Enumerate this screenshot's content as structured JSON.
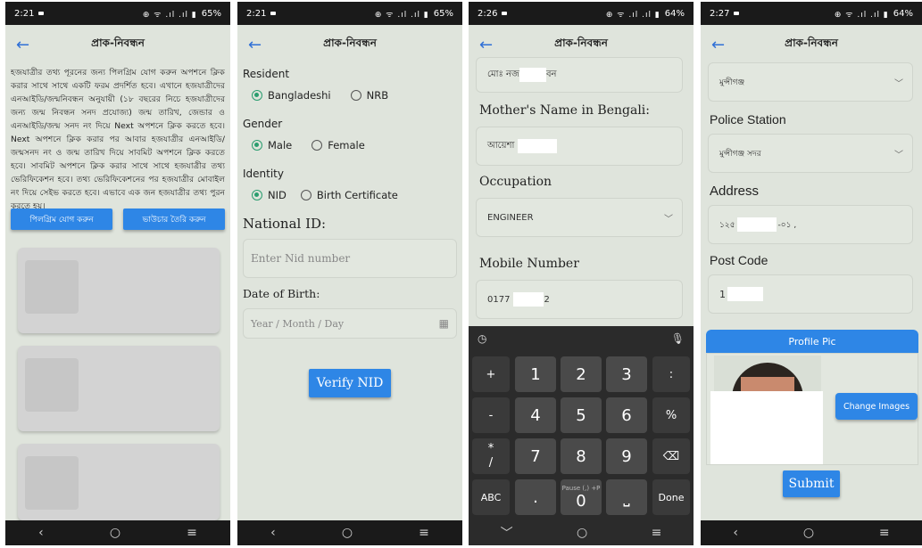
{
  "common": {
    "app_title": "প্রাক-নিবন্ধন",
    "nav": [
      "‹",
      "○",
      "≡"
    ]
  },
  "phone1": {
    "time": "2:21",
    "battery": "65%",
    "paragraph": "হজযাত্রীর তথ্য পূরনের জন্য পিলগ্রিম যোগ করুন অপশনে ক্লিক করার সাথে সাথে একটি ফরম প্রদর্শিত হবে। এখানে হজযাত্রীদের এনআইডি/জন্মনিবন্ধন অনুযায়ী (১৮ বছরের নিচে হজযাত্রীদের জন্য জন্ম নিবন্ধন সনদ প্রযোজ্য) জন্ম তারিখ, জেন্ডার ও এনআইডি/জন্ম সনদ নং দিয়ে Next অপশনে ক্লিক করতে হবে। Next অপশনে ক্লিক করার পর আবার হজযাত্রীর এনআইডি/জন্মসনদ নং ও জন্ম তারিখ দিয়ে সাবমিট অপশনে ক্লিক করতে হবে। সাবমিট অপশনে ক্লিক করার সাথে সাথে হজযাত্রীর তথ্য ভেরিফিকেশন হবে। তথ্য ভেরিফিকেশনের পর হজযাত্রীর মোবাইল নং দিয়ে সেইভ করতে হবে। এভাবে এক জন হজযাত্রীর তথ্য পুরন করতে হয়।",
    "btn_add": "পিলগ্রিম যোগ করুন",
    "btn_voucher": "ভাউচার তৈরি করুন"
  },
  "phone2": {
    "time": "2:21",
    "battery": "65%",
    "resident_label": "Resident",
    "resident_opt1": "Bangladeshi",
    "resident_opt2": "NRB",
    "gender_label": "Gender",
    "gender_opt1": "Male",
    "gender_opt2": "Female",
    "identity_label": "Identity",
    "identity_opt1": "NID",
    "identity_opt2": "Birth Certificate",
    "nid_label": "National ID:",
    "nid_placeholder": "Enter Nid number",
    "dob_label": "Date of Birth:",
    "dob_placeholder": "Year / Month / Day",
    "verify_btn": "Verify NID"
  },
  "phone3": {
    "time": "2:26",
    "battery": "64%",
    "name_prefix": "মোঃ নজ",
    "name_suffix": "বন",
    "mother_label": "Mother's Name in Bengali:",
    "mother_value": "আয়েশা",
    "occupation_label": "Occupation",
    "occupation_value": "ENGINEER",
    "mobile_label": "Mobile Number",
    "mobile_prefix": "0177",
    "mobile_suffix": "2",
    "keys": {
      "plus": "+",
      "minus": "-",
      "star": "*",
      "slash": "/",
      "abc": "ABC",
      "dot": ".",
      "percent": "%",
      "k1": "1",
      "k2": "2",
      "k3": "3",
      "k4": "4",
      "k5": "5",
      "k6": "6",
      "k7": "7",
      "k8": "8",
      "k9": "9",
      "k0": "0",
      "colon": ":",
      "done": "Done",
      "pause": "Pause (,) +P"
    }
  },
  "phone4": {
    "time": "2:27",
    "battery": "64%",
    "district_value": "মুন্সীগঞ্জ",
    "police_label": "Police Station",
    "police_value": "মুন্সীগঞ্জ সদর",
    "address_label": "Address",
    "address_prefix": "১২৫",
    "address_suffix": "-০১ ,",
    "post_label": "Post Code",
    "post_value": "1",
    "profile_pic": "Profile Pic",
    "change_btn": "Change Images",
    "submit_btn": "Submit"
  }
}
